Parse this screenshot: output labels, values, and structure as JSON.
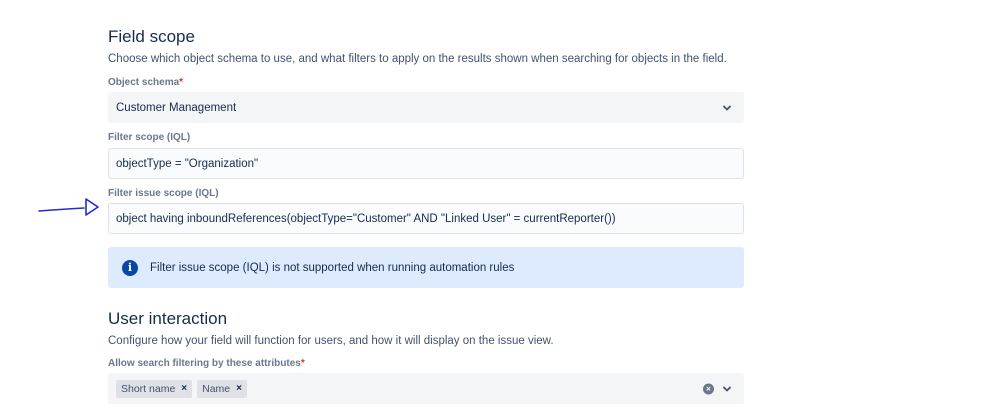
{
  "field_scope": {
    "title": "Field scope",
    "description": "Choose which object schema to use, and what filters to apply on the results shown when searching for objects in the field.",
    "object_schema_label": "Object schema",
    "object_schema_required": "*",
    "object_schema_value": "Customer Management",
    "filter_scope_label": "Filter scope (IQL)",
    "filter_scope_value": "objectType = \"Organization\"",
    "filter_issue_scope_label": "Filter issue scope (IQL)",
    "filter_issue_scope_value": "object having inboundReferences(objectType=\"Customer\" AND \"Linked User\" = currentReporter())",
    "info_icon": "i",
    "info_message": "Filter issue scope (IQL) is not supported when running automation rules"
  },
  "user_interaction": {
    "title": "User interaction",
    "description": "Configure how your field will function for users, and how it will display on the issue view.",
    "search_attributes_label": "Allow search filtering by these attributes",
    "search_attributes_required": "*",
    "chips": [
      {
        "label": "Short name",
        "remove": "×"
      },
      {
        "label": "Name",
        "remove": "×"
      }
    ],
    "clear_symbol": "×"
  },
  "annotation": {
    "type": "hand-drawn arrow",
    "color": "#1f2ccf"
  }
}
